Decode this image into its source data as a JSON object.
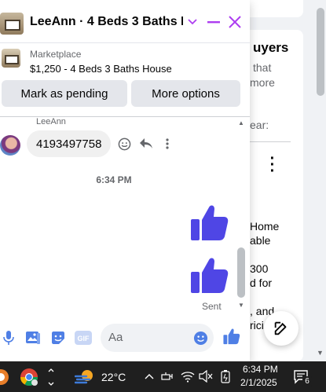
{
  "background": {
    "heading": "uyers",
    "lines": [
      "that",
      "more",
      "ear:",
      "Home",
      "able",
      "300",
      "d for",
      ", and",
      "rici"
    ]
  },
  "chat": {
    "title": "LeeAnn · 4 Beds 3 Baths H...",
    "listing": {
      "source": "Marketplace",
      "detail": "$1,250 - 4 Beds 3 Baths House",
      "pending_label": "Mark as pending",
      "more_label": "More options"
    },
    "sender_name": "LeeAnn",
    "incoming_message": "4193497758",
    "time_separator": "6:34 PM",
    "sent_status": "Sent",
    "composer": {
      "placeholder": "Aa"
    },
    "colors": {
      "accent": "#ad3ef0",
      "messenger_blue": "#5b4de0",
      "thumb": "#4f46e5"
    }
  },
  "taskbar": {
    "temperature": "22°C",
    "time": "6:34 PM",
    "date": "2/1/2025",
    "notification_count": "6",
    "icons": [
      "app-icon",
      "chrome-icon",
      "chevron-up-icon",
      "weather-icon",
      "network-icon",
      "wifi-icon",
      "volume-mute-icon",
      "battery-icon",
      "notification-icon"
    ]
  }
}
